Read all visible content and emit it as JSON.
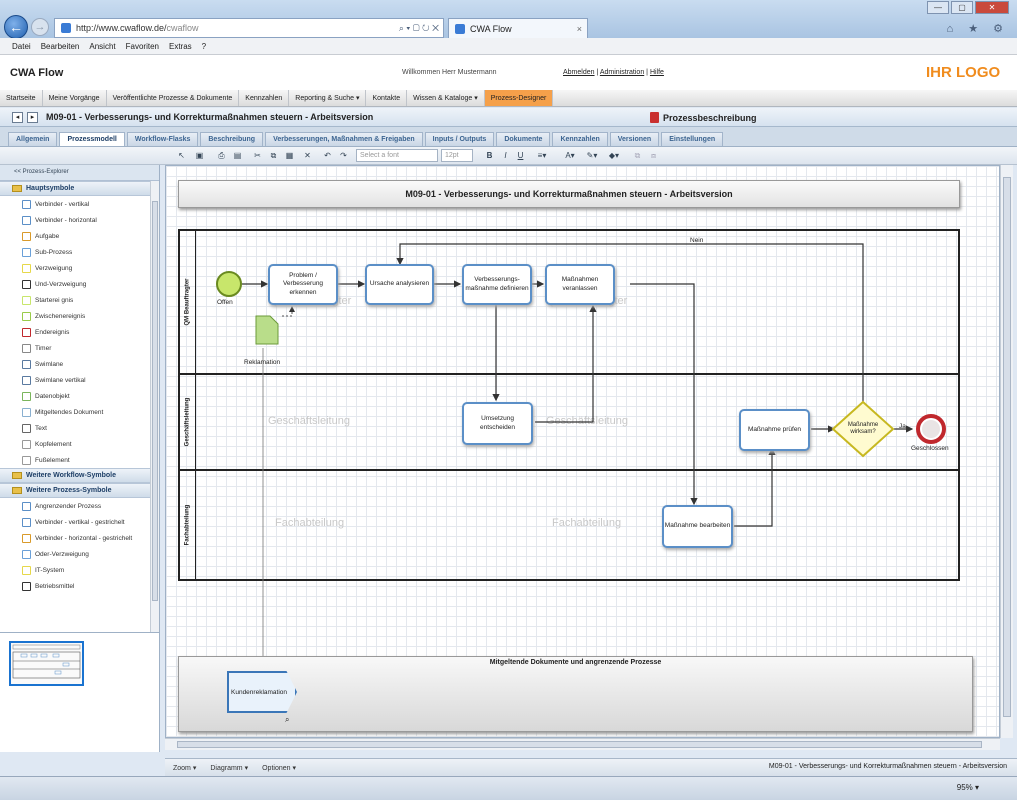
{
  "browser": {
    "url_host": "http://www.cwaflow.de/",
    "url_path": "cwaflow",
    "url_tools": "⌕ ▾ ▢ ↻ ✕",
    "tab_title": "CWA Flow",
    "tab_close": "×",
    "window_buttons": [
      "—",
      "▢",
      "✕"
    ],
    "tools_icons": "⌂ ★ ⚙"
  },
  "menu": [
    "Datei",
    "Bearbeiten",
    "Ansicht",
    "Favoriten",
    "Extras",
    "?"
  ],
  "app": {
    "title": "CWA Flow",
    "welcome": "Willkommen Herr Mustermann",
    "links": [
      "Abmelden",
      "Administration",
      "Hilfe"
    ],
    "logo": "IHR LOGO"
  },
  "mainnav": [
    {
      "label": "Startseite"
    },
    {
      "label": "Meine Vorgänge"
    },
    {
      "label": "Veröffentlichte Prozesse & Dokumente"
    },
    {
      "label": "Kennzahlen"
    },
    {
      "label": "Reporting & Suche ▾"
    },
    {
      "label": "Kontakte"
    },
    {
      "label": "Wissen & Kataloge ▾"
    },
    {
      "label": "Prozess-Designer",
      "active": true
    }
  ],
  "subhead": {
    "prev": "◂",
    "next": "▸",
    "doc_title": "M09-01 - Verbesserungs- und Korrekturmaßnahmen steuern - Arbeitsversion",
    "prozessbeschreibung": "Prozessbeschreibung"
  },
  "tabs": [
    {
      "label": "Allgemein"
    },
    {
      "label": "Prozessmodell",
      "active": true
    },
    {
      "label": "Workflow-Flasks"
    },
    {
      "label": "Beschreibung"
    },
    {
      "label": "Verbesserungen, Maßnahmen & Freigaben"
    },
    {
      "label": "Inputs / Outputs"
    },
    {
      "label": "Dokumente"
    },
    {
      "label": "Kennzahlen"
    },
    {
      "label": "Versionen"
    },
    {
      "label": "Einstellungen"
    }
  ],
  "toolbar": {
    "collapse": "«",
    "font_placeholder": "Select a font",
    "font_size": "12pt",
    "bold": "B",
    "italic": "I",
    "underline": "U",
    "icons": {
      "pointer": "↖",
      "save": "▣",
      "print": "⎙",
      "pdf": "▤",
      "cut": "✂",
      "copy": "⧉",
      "paste": "▦",
      "delete": "✕",
      "undo": "↶",
      "redo": "↷",
      "align": "≡▾",
      "font_color": "A▾",
      "highlight": "✎▾",
      "fill": "◆▾",
      "group": "⧉",
      "ungroup": "⧈"
    }
  },
  "explorer": {
    "header": "<< Prozess-Explorer",
    "groups": [
      {
        "label": "Hauptsymbole",
        "items": [
          "Verbinder - vertikal",
          "Verbinder - horizontal",
          "Aufgabe",
          "Sub-Prozess",
          "Verzweigung",
          "Und-Verzweigung",
          "Starterei gnis",
          "Zwischenereignis",
          "Endereignis",
          "Timer",
          "Swimlane",
          "Swimlane vertikal",
          "Datenobjekt",
          "Mitgeltendes Dokument",
          "Text",
          "Kopfelement",
          "Fußelement"
        ]
      },
      {
        "label": "Weitere Workflow-Symbole",
        "items": []
      },
      {
        "label": "Weitere Prozess-Symbole",
        "items": [
          "Angrenzender Prozess",
          "Verbinder - vertikal - gestrichelt",
          "Verbinder - horizontal - gestrichelt",
          "Oder-Verzweigung",
          "IT-System",
          "Betriebsmittel"
        ]
      }
    ]
  },
  "diagram": {
    "title": "M09-01 - Verbesserungs- und Korrekturmaßnahmen steuern - Arbeitsversion",
    "lanes": [
      {
        "label": "QM Beauftragter",
        "watermarks": [
          "QM Beauftragter",
          "QM Beauftragter"
        ]
      },
      {
        "label": "Geschäftsleitung",
        "watermarks": [
          "Geschäftsleitung",
          "Geschäftsleitung"
        ]
      },
      {
        "label": "Fachabteilung",
        "watermarks": [
          "Fachabteilung",
          "Fachabteilung"
        ]
      }
    ],
    "start_event": "Offen",
    "end_event": "Geschlossen",
    "data_object": "Reklamation",
    "tasks": {
      "t1": "Problem / Verbesserung erkennen",
      "t2": "Ursache analysieren",
      "t3": "Verbesserungs-maßnahme definieren",
      "t4": "Maßnahmen veranlassen",
      "t5": "Umsetzung entscheiden",
      "t6": "Maßnahme prüfen",
      "t7": "Maßnahme bearbeiten"
    },
    "gateway": "Maßnahme wirksam?",
    "flow_labels": {
      "nein": "Nein",
      "ja": "Ja"
    },
    "docs_title": "Mitgeltende Dokumente und angrenzende Prozesse",
    "adjacent_process": "Kundenreklamation"
  },
  "bottombar": {
    "zoom": "Zoom ▾",
    "diagramm": "Diagramm ▾",
    "optionen": "Optionen ▾",
    "right_text": "M09-01 - Verbesserungs- und Korrekturmaßnahmen steuern - Arbeitsversion"
  },
  "status": {
    "zoom": "95% ▾"
  },
  "colors": {
    "accent": "#f5a04a",
    "logo": "#f08c1e",
    "task_border": "#5b8fc7",
    "gateway": "#e6d84a",
    "start": "#c8e66b",
    "end": "#c0282d"
  }
}
